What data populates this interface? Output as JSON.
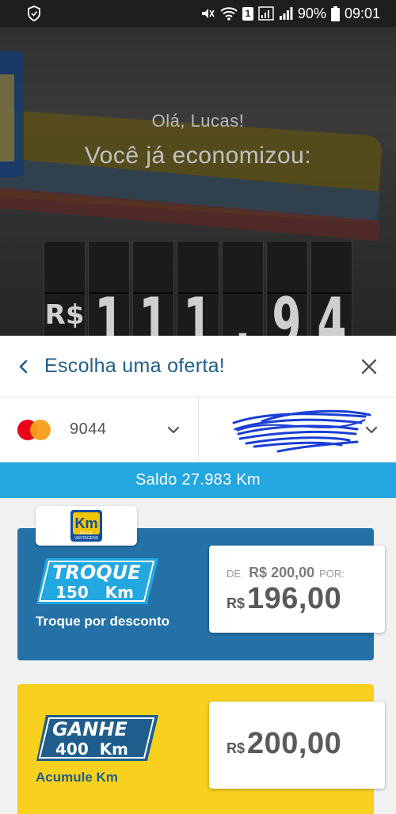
{
  "status_bar": {
    "battery": "90%",
    "time": "09:01",
    "sim_badge": "1",
    "icons": [
      "shield-icon",
      "mute-icon",
      "wifi-icon",
      "sim-icon",
      "signal-icon",
      "signal-icon",
      "battery-icon"
    ]
  },
  "hero": {
    "greeting": "Olá, Lucas!",
    "title": "Você já economizou:",
    "counter": [
      "R$",
      "1",
      "1",
      "1",
      ",",
      "9",
      "4"
    ]
  },
  "sheet": {
    "title": "Escolha uma oferta!",
    "back_icon": "chevron-left-icon",
    "close_icon": "close-icon"
  },
  "payment": {
    "card_brand": "mastercard",
    "card_last_digits": "9044",
    "account_value": ""
  },
  "balance": {
    "label": "Saldo 27.983 Km"
  },
  "logo": {
    "text": "Km",
    "subtext": "Km DE VANTAGENS"
  },
  "offers": [
    {
      "badge_line1": "TROQUE",
      "badge_line2": "150   Km",
      "description": "Troque por desconto",
      "price_from_label": "DE",
      "price_old": "R$ 200,00",
      "price_por_label": "POR:",
      "currency": "R$",
      "price": "196,00",
      "color": "#2471a8"
    },
    {
      "badge_line1": "GANHE",
      "badge_line2": "400  Km",
      "description": "Acumule Km",
      "currency": "R$",
      "price": "200,00",
      "color": "#f7d11d"
    }
  ],
  "colors": {
    "brand_blue": "#1f5e8c",
    "balance_bar": "#22a7e0",
    "offer_blue": "#2471a8",
    "offer_yellow": "#f7d11d"
  }
}
